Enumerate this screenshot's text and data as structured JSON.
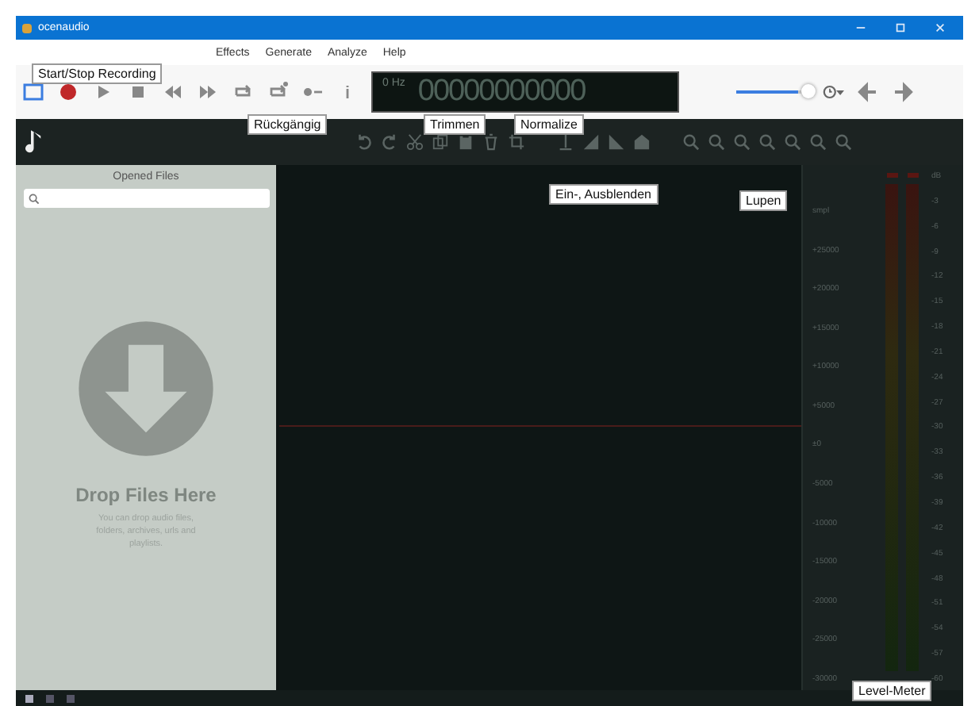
{
  "window": {
    "title": "ocenaudio"
  },
  "menu": [
    "Effects",
    "Generate",
    "Analyze",
    "Help"
  ],
  "time_display": {
    "rate": "0 Hz",
    "digits": "00000000000"
  },
  "volume": {
    "level": 0.85
  },
  "sidebar": {
    "title": "Opened Files",
    "drop_title": "Drop Files Here",
    "drop_text": "You can drop audio files, folders, archives, urls and playlists."
  },
  "amplitude_scale": [
    "smpl",
    "+25000",
    "+20000",
    "+15000",
    "+10000",
    "+5000",
    "±0",
    "-5000",
    "-10000",
    "-15000",
    "-20000",
    "-25000",
    "-30000"
  ],
  "db_scale": [
    "dB",
    "-3",
    "-6",
    "-9",
    "-12",
    "-15",
    "-18",
    "-21",
    "-24",
    "-27",
    "-30",
    "-33",
    "-36",
    "-39",
    "-42",
    "-45",
    "-48",
    "-51",
    "-54",
    "-57",
    "-60"
  ],
  "meters": [
    {
      "level": 0
    },
    {
      "level": 0
    }
  ],
  "callouts": [
    {
      "text": "Start/Stop Recording"
    },
    {
      "text": "Rückgängig"
    },
    {
      "text": "Trimmen"
    },
    {
      "text": "Normalize"
    },
    {
      "text": "Ein-, Ausblenden"
    },
    {
      "text": "Lupen"
    },
    {
      "text": "Level-Meter"
    }
  ]
}
